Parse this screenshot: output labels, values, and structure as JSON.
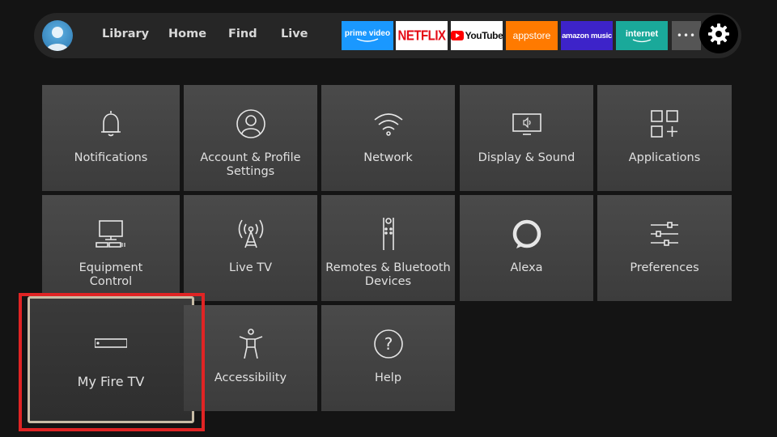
{
  "nav": {
    "items": [
      {
        "label": "Library"
      },
      {
        "label": "Home"
      },
      {
        "label": "Find"
      },
      {
        "label": "Live"
      }
    ]
  },
  "apps": [
    {
      "label": "prime video",
      "icon": "prime-video-logo",
      "bg": "#1a98ff",
      "color": "#ffffff"
    },
    {
      "label": "NETFLIX",
      "icon": "netflix-logo",
      "bg": "#ffffff",
      "color": "#e50914"
    },
    {
      "label": "YouTube",
      "icon": "youtube-logo",
      "bg": "#ffffff",
      "color": "#111111"
    },
    {
      "label": "appstore",
      "icon": "appstore-logo",
      "bg": "#ff7a00",
      "color": "#ffffff"
    },
    {
      "label": "amazon music",
      "icon": "amazon-music-logo",
      "bg": "#3d23c9",
      "color": "#ffffff"
    },
    {
      "label": "internet",
      "icon": "internet-logo",
      "bg": "#1aa99a",
      "color": "#ffffff"
    }
  ],
  "more_label": "•••",
  "settings_tiles": [
    {
      "label": "Notifications",
      "icon": "bell-icon"
    },
    {
      "label": "Account & Profile Settings",
      "icon": "profile-icon"
    },
    {
      "label": "Network",
      "icon": "wifi-icon"
    },
    {
      "label": "Display & Sound",
      "icon": "display-sound-icon"
    },
    {
      "label": "Applications",
      "icon": "applications-icon"
    },
    {
      "label": "Equipment Control",
      "icon": "equipment-icon"
    },
    {
      "label": "Live TV",
      "icon": "antenna-icon"
    },
    {
      "label": "Remotes & Bluetooth Devices",
      "icon": "remote-icon"
    },
    {
      "label": "Alexa",
      "icon": "alexa-icon"
    },
    {
      "label": "Preferences",
      "icon": "sliders-icon"
    },
    {
      "label": "My Fire TV",
      "icon": "fire-tv-device-icon",
      "selected": true
    },
    {
      "label": "Accessibility",
      "icon": "accessibility-icon"
    },
    {
      "label": "Help",
      "icon": "help-icon"
    }
  ],
  "colors": {
    "background": "#141414",
    "tile": "#444444",
    "highlight": "#e02424",
    "focus_border": "#c8bca6"
  }
}
